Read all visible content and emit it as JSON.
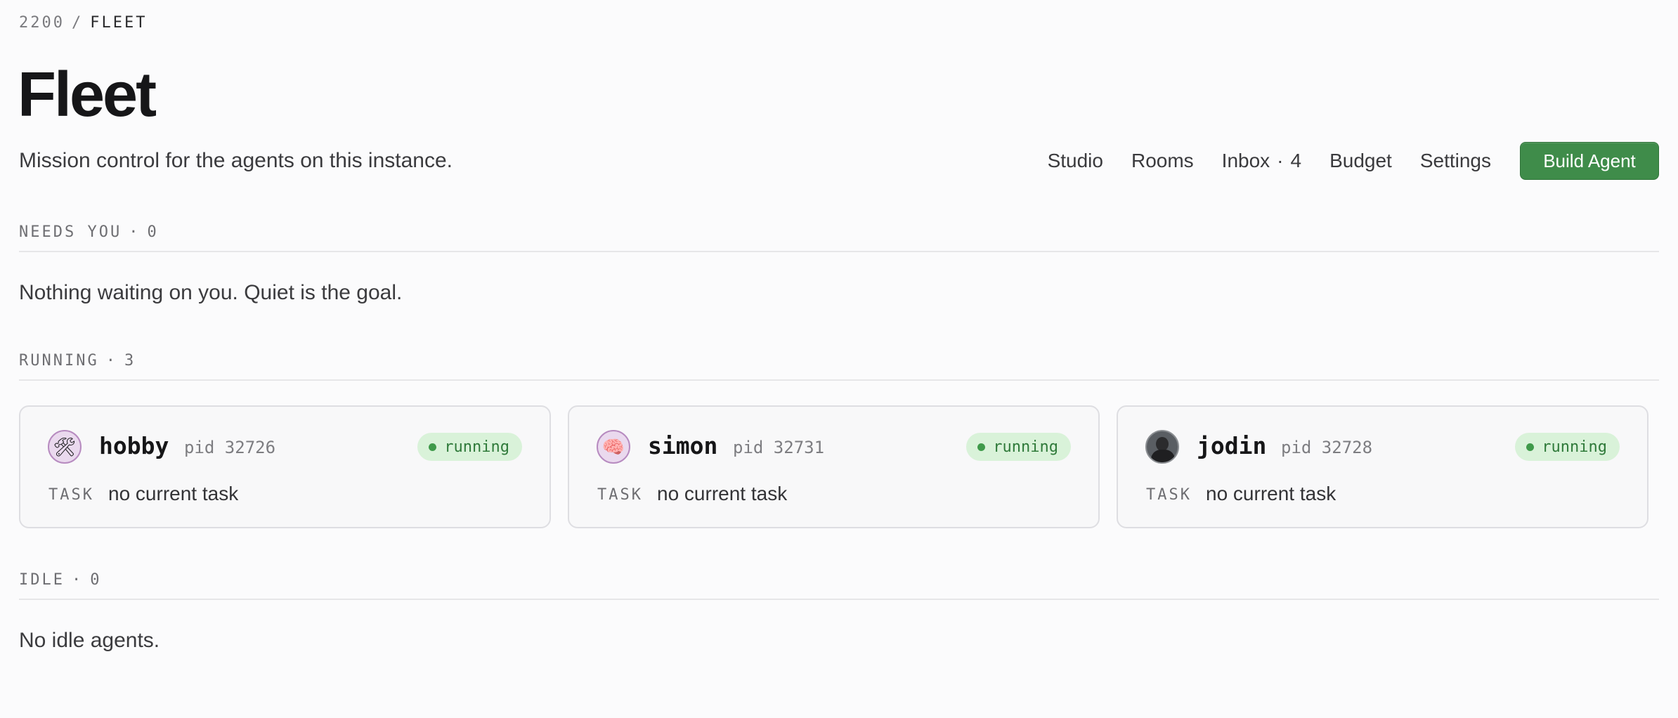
{
  "breadcrumb": {
    "root": "2200",
    "separator": "/",
    "current": "FLEET"
  },
  "page": {
    "title": "Fleet",
    "subtitle": "Mission control for the agents on this instance."
  },
  "nav": {
    "studio": "Studio",
    "rooms": "Rooms",
    "inbox": "Inbox",
    "inbox_sep": "·",
    "inbox_count": "4",
    "budget": "Budget",
    "settings": "Settings",
    "build_agent": "Build Agent",
    "accent_color": "#3f8c4a"
  },
  "needs_you": {
    "label": "NEEDS YOU",
    "sep": "·",
    "count": "0",
    "empty_text": "Nothing waiting on you. Quiet is the goal."
  },
  "running": {
    "label": "RUNNING",
    "sep": "·",
    "count": "3",
    "agents": [
      {
        "name": "hobby",
        "pid": "pid 32726",
        "status": "running",
        "task_label": "TASK",
        "task": "no current task",
        "avatar": "hammer-wrench-icon",
        "avatar_glyph": "🛠"
      },
      {
        "name": "simon",
        "pid": "pid 32731",
        "status": "running",
        "task_label": "TASK",
        "task": "no current task",
        "avatar": "brain-icon",
        "avatar_glyph": "🧠"
      },
      {
        "name": "jodin",
        "pid": "pid 32728",
        "status": "running",
        "task_label": "TASK",
        "task": "no current task",
        "avatar": "person-photo"
      }
    ],
    "status_color": "#3f9a4a"
  },
  "idle": {
    "label": "IDLE",
    "sep": "·",
    "count": "0",
    "empty_text": "No idle agents."
  }
}
